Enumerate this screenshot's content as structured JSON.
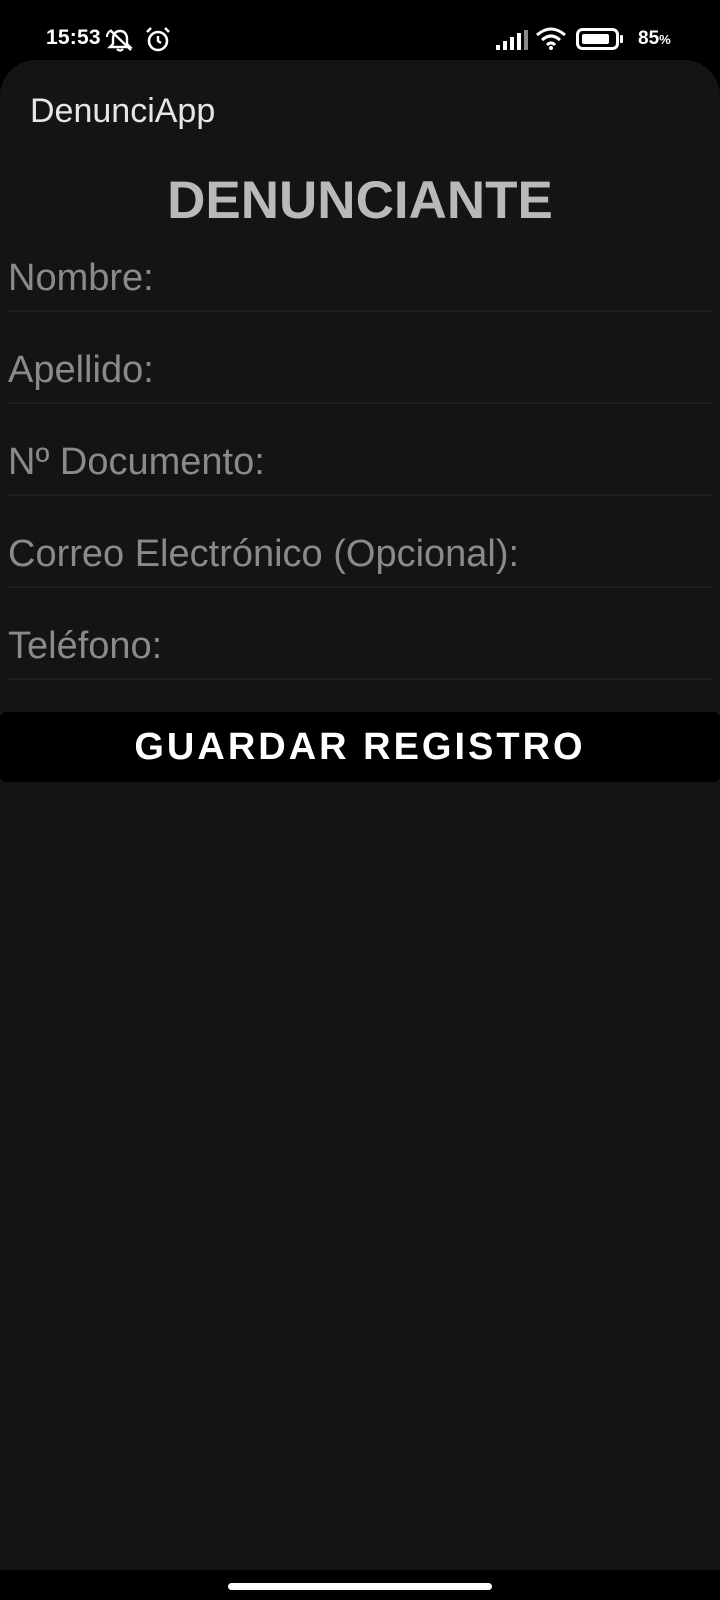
{
  "status_bar": {
    "time": "15:53",
    "battery_level": "85",
    "battery_unit": "%",
    "icons": [
      "mute-icon",
      "alarm-icon",
      "signal-icon",
      "wifi-icon",
      "battery-icon"
    ]
  },
  "app": {
    "title": "DenunciApp"
  },
  "form": {
    "heading": "DENUNCIANTE",
    "fields": [
      {
        "placeholder": "Nombre:",
        "value": ""
      },
      {
        "placeholder": "Apellido:",
        "value": ""
      },
      {
        "placeholder": "Nº Documento:",
        "value": ""
      },
      {
        "placeholder": "Correo Electrónico (Opcional):",
        "value": ""
      },
      {
        "placeholder": "Teléfono:",
        "value": ""
      }
    ],
    "save_label": "GUARDAR REGISTRO"
  },
  "colors": {
    "app_background": "#141414",
    "heading": "#b9b9b9",
    "placeholder": "#8a8a8a",
    "button_background": "#000000",
    "button_text": "#ffffff"
  }
}
